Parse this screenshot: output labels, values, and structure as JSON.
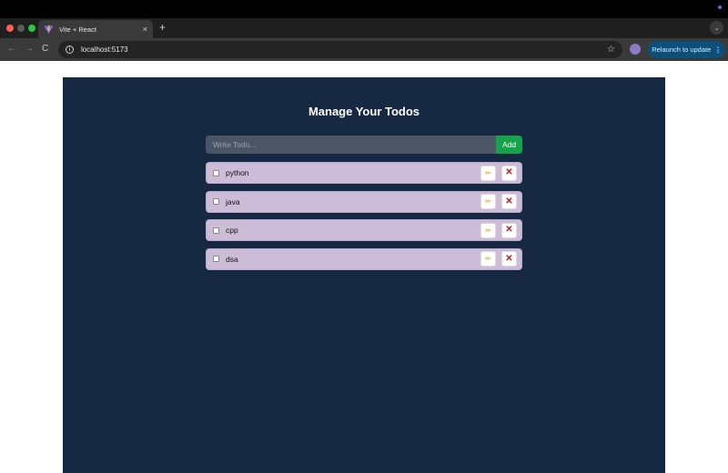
{
  "browser": {
    "tab_title": "Vite + React",
    "tab_close": "×",
    "new_tab": "+",
    "tab_menu": "⌄",
    "url": "localhost:5173",
    "relaunch_label": "Relaunch to update",
    "relaunch_menu": "⋮",
    "nav": {
      "back": "←",
      "forward": "→",
      "reload": "C"
    },
    "star": "☆",
    "info": "i"
  },
  "app": {
    "title": "Manage Your Todos",
    "input_placeholder": "Write Todo...",
    "input_value": "",
    "add_label": "Add",
    "edit_glyph": "✏",
    "delete_glyph": "✕",
    "todos": [
      {
        "text": "python",
        "completed": false
      },
      {
        "text": "java",
        "completed": false
      },
      {
        "text": "cpp",
        "completed": false
      },
      {
        "text": "dsa",
        "completed": false
      }
    ]
  },
  "colors": {
    "app_bg": "#172842",
    "todo_bg": "#ccbcd8",
    "add_button": "#16a34a",
    "delete_icon": "#c41a1a",
    "relaunch_bg": "#0b4f7a"
  }
}
